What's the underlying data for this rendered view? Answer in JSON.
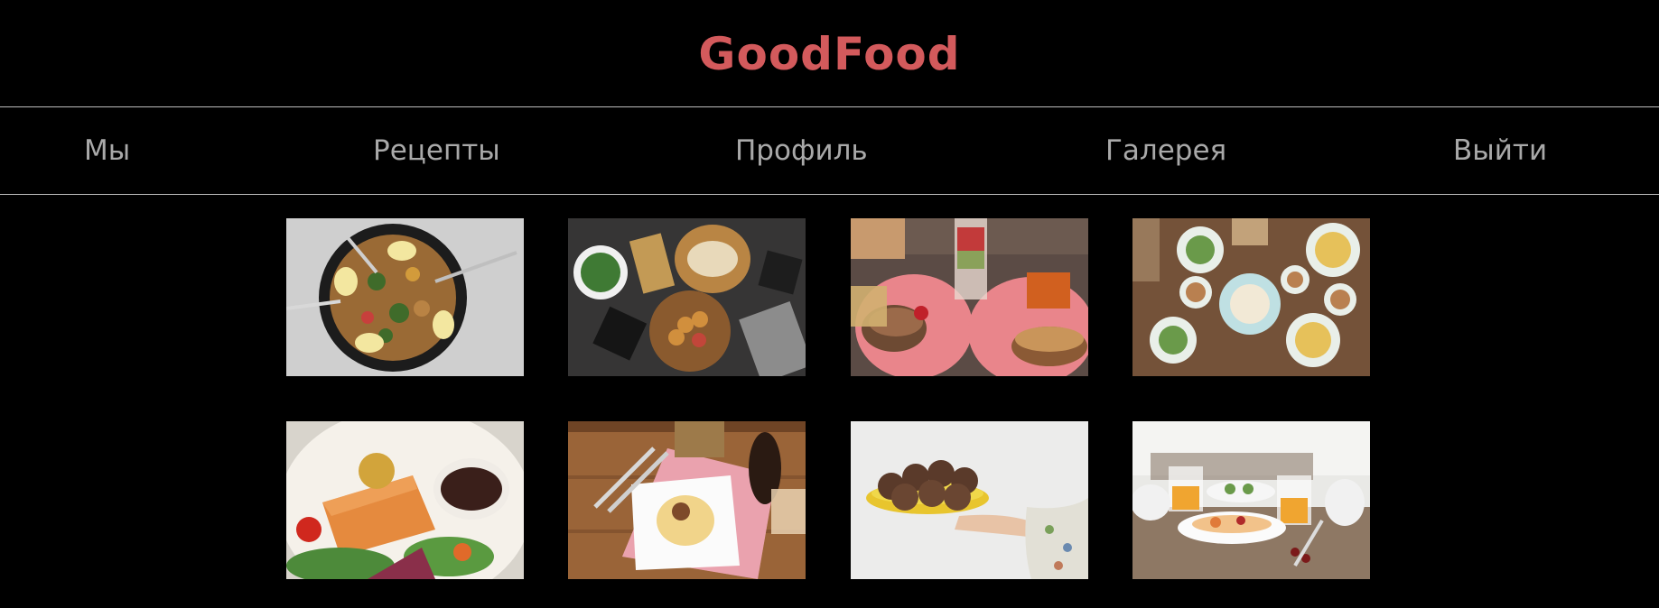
{
  "header": {
    "logo_text": "GoodFood",
    "logo_color": "#d35a5c"
  },
  "nav": {
    "items": [
      {
        "label": "Мы"
      },
      {
        "label": "Рецепты"
      },
      {
        "label": "Профиль"
      },
      {
        "label": "Галерея"
      },
      {
        "label": "Выйти"
      }
    ],
    "text_color": "#a9a9a9",
    "divider_color": "#bdbdbd"
  },
  "gallery": {
    "photos": [
      {
        "icon": "paella-pan-photo"
      },
      {
        "icon": "appetizer-table-photo"
      },
      {
        "icon": "burgers-and-fries-photo"
      },
      {
        "icon": "breakfast-table-photo"
      },
      {
        "icon": "salmon-salad-photo"
      },
      {
        "icon": "pasta-plate-photo"
      },
      {
        "icon": "muffins-plate-photo"
      },
      {
        "icon": "breakfast-window-photo"
      }
    ]
  },
  "colors": {
    "background": "#000000"
  }
}
